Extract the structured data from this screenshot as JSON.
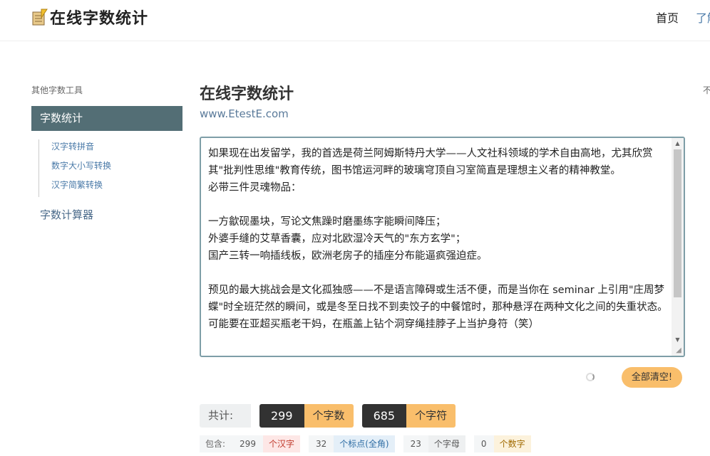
{
  "header": {
    "logo_text": "在线字数统计",
    "nav": {
      "home": "首页",
      "about": "了解"
    }
  },
  "sidebar": {
    "title": "其他字数工具",
    "active_item": "字数统计",
    "sub_items": [
      "汉字转拼音",
      "数字大小写转换",
      "汉字简繁转换"
    ],
    "item_calc": "字数计算器"
  },
  "main": {
    "title": "在线字数统计",
    "url": "www.EtestE.com",
    "textarea_value": "如果现在出发留学，我的首选是荷兰阿姆斯特丹大学——人文社科领域的学术自由高地，尤其欣赏其\"批判性思维\"教育传统，图书馆运河畔的玻璃穹顶自习室简直是理想主义者的精神教堂。\n必带三件灵魂物品：\n\n一方歙砚墨块，写论文焦躁时磨墨练字能瞬间降压；\n外婆手缝的艾草香囊，应对北欧湿冷天气的\"东方玄学\"；\n国产三转一响插线板，欧洲老房子的插座分布能逼疯强迫症。\n\n预见的最大挑战会是文化孤独感——不是语言障碍或生活不便，而是当你在 seminar 上引用\"庄周梦蝶\"时全班茫然的瞬间，或是冬至日找不到卖饺子的中餐馆时，那种悬浮在两种文化之间的失重状态。可能要在亚超买瓶老干妈，在瓶盖上钻个洞穿绳挂脖子上当护身符（笑）",
    "clear_button": "全部清空!",
    "right_cut_text": "不"
  },
  "stats": {
    "total_label": "共计:",
    "char_count": "299",
    "char_unit": "个字数",
    "symbol_count": "685",
    "symbol_unit": "个字符",
    "contains_label": "包含:",
    "han_count": "299",
    "han_unit": "个汉字",
    "punct_count": "32",
    "punct_unit": "个标点(全角)",
    "letter_count": "23",
    "letter_unit": "个字母",
    "digit_count": "0",
    "digit_unit": "个数字"
  }
}
